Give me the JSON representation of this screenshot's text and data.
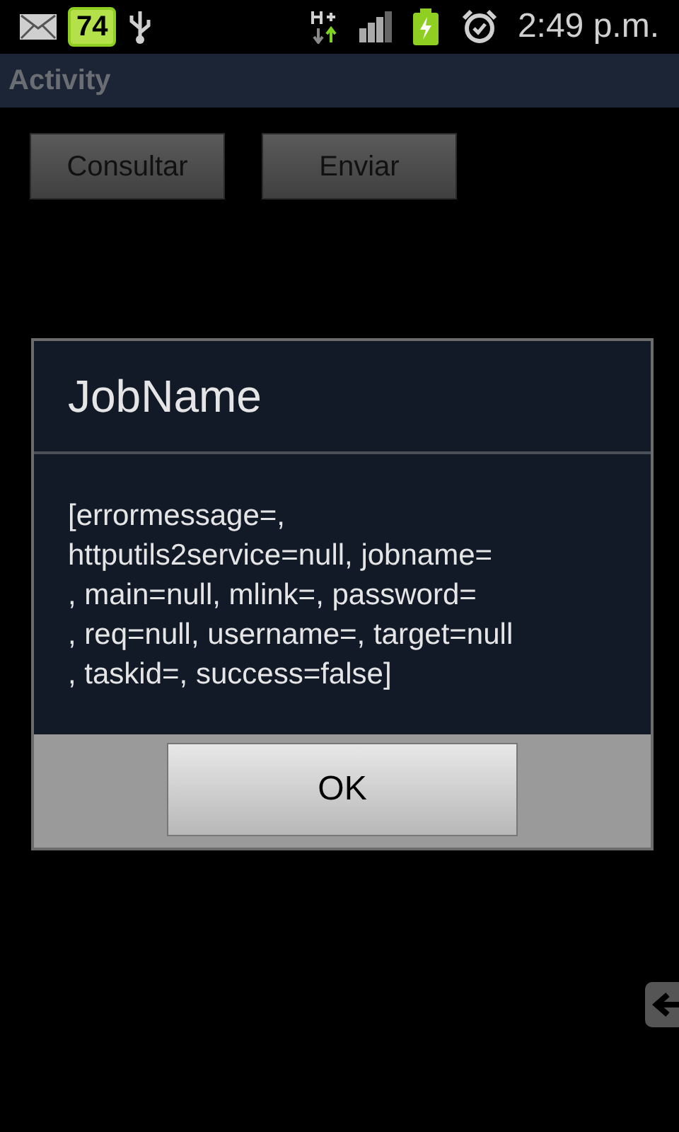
{
  "status_bar": {
    "battery_percent": "74",
    "time": "2:49 p.m."
  },
  "app_bar": {
    "title": "Activity"
  },
  "buttons": [
    {
      "label": "Consultar"
    },
    {
      "label": "Enviar"
    }
  ],
  "dialog": {
    "title": "JobName",
    "message_lines": [
      "[errormessage=,",
      "httputils2service=null, jobname=",
      ", main=null, mlink=, password=",
      ", req=null, username=, target=null",
      ", taskid=, success=false]"
    ],
    "button": "OK"
  }
}
